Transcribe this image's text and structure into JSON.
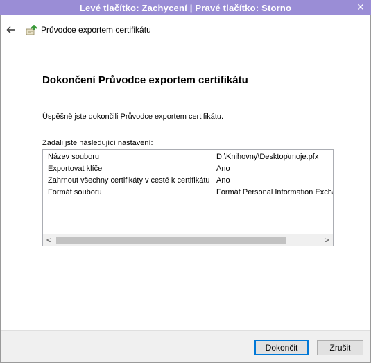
{
  "banner": {
    "text": "Levé tlačítko: Zachycení | Pravé tlačítko: Storno"
  },
  "window": {
    "close_glyph": "✕"
  },
  "header": {
    "back_icon": "back-arrow-icon",
    "wizard_icon": "certificate-icon",
    "title": "Průvodce exportem certifikátu"
  },
  "main": {
    "heading": "Dokončení Průvodce exportem certifikátu",
    "success_text": "Úspěšně jste dokončili Průvodce exportem certifikátu.",
    "settings_label": "Zadali jste následující nastavení:",
    "settings": [
      {
        "key": "Název souboru",
        "value": "D:\\Knihovny\\Desktop\\moje.pfx"
      },
      {
        "key": "Exportovat klíče",
        "value": "Ano"
      },
      {
        "key": "Zahrnout všechny certifikáty v cestě k certifikátu",
        "value": "Ano"
      },
      {
        "key": "Formát souboru",
        "value": "Formát Personal Information Excha"
      }
    ],
    "scroll_left": "<",
    "scroll_right": ">"
  },
  "footer": {
    "finish_label": "Dokončit",
    "cancel_label": "Zrušit"
  },
  "colors": {
    "banner": "#9a8dd6",
    "accent": "#0078d7",
    "footer_bg": "#f0f0f0"
  }
}
